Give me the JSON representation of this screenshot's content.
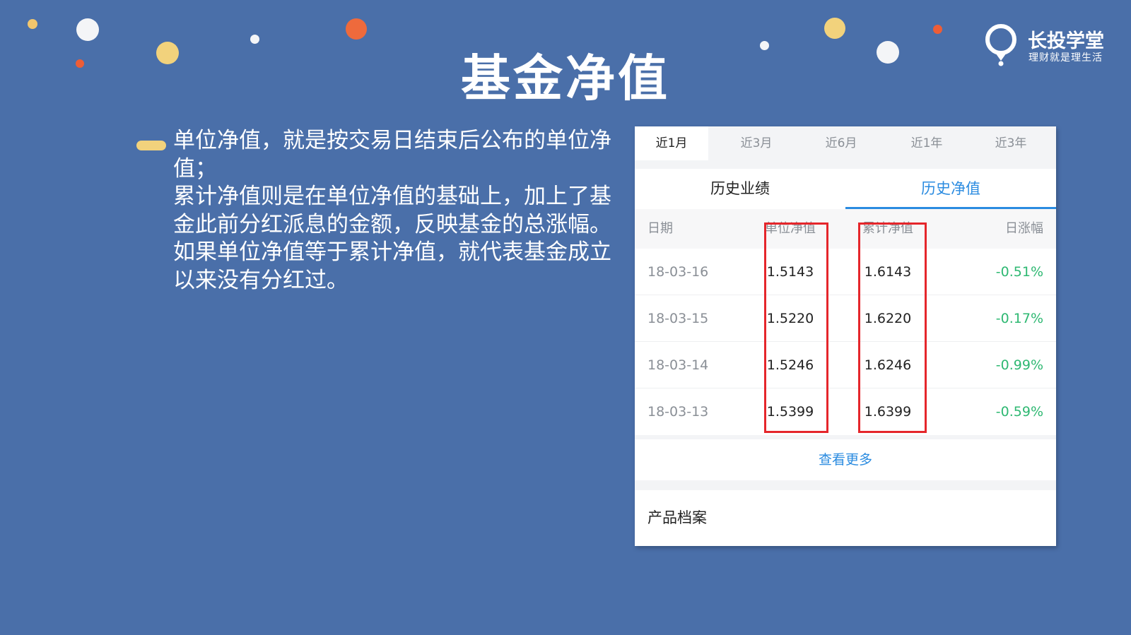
{
  "slide": {
    "title": "基金净值",
    "logo": {
      "name": "长投学堂",
      "slogan": "理财就是理生活"
    },
    "description": [
      "单位净值，就是按交易日结束后公布的单位净值；",
      "累计净值则是在单位净值的基础上，加上了基金此前分红派息的金额，反映基金的总涨幅。",
      "如果单位净值等于累计净值，就代表基金成立以来没有分红过。"
    ],
    "colors": {
      "background": "#4a6fa9",
      "accent_blue": "#2a8be0",
      "negative_change_green": "#2eb872",
      "highlight_red": "#e5262b",
      "bullet_yellow": "#f2d27c"
    }
  },
  "fund_card": {
    "range_tabs": [
      "近1月",
      "近3月",
      "近6月",
      "近1年",
      "近3年"
    ],
    "active_range": "近1月",
    "sub_tabs": [
      "历史业绩",
      "历史净值"
    ],
    "active_sub_tab": "历史净值",
    "table": {
      "headers": [
        "日期",
        "单位净值",
        "累计净值",
        "日涨幅"
      ],
      "rows": [
        [
          "18-03-16",
          "1.5143",
          "1.6143",
          "-0.51%"
        ],
        [
          "18-03-15",
          "1.5220",
          "1.6220",
          "-0.17%"
        ],
        [
          "18-03-14",
          "1.5246",
          "1.6246",
          "-0.99%"
        ],
        [
          "18-03-13",
          "1.5399",
          "1.6399",
          "-0.59%"
        ]
      ]
    },
    "more_label": "查看更多",
    "archive_label": "产品档案"
  }
}
